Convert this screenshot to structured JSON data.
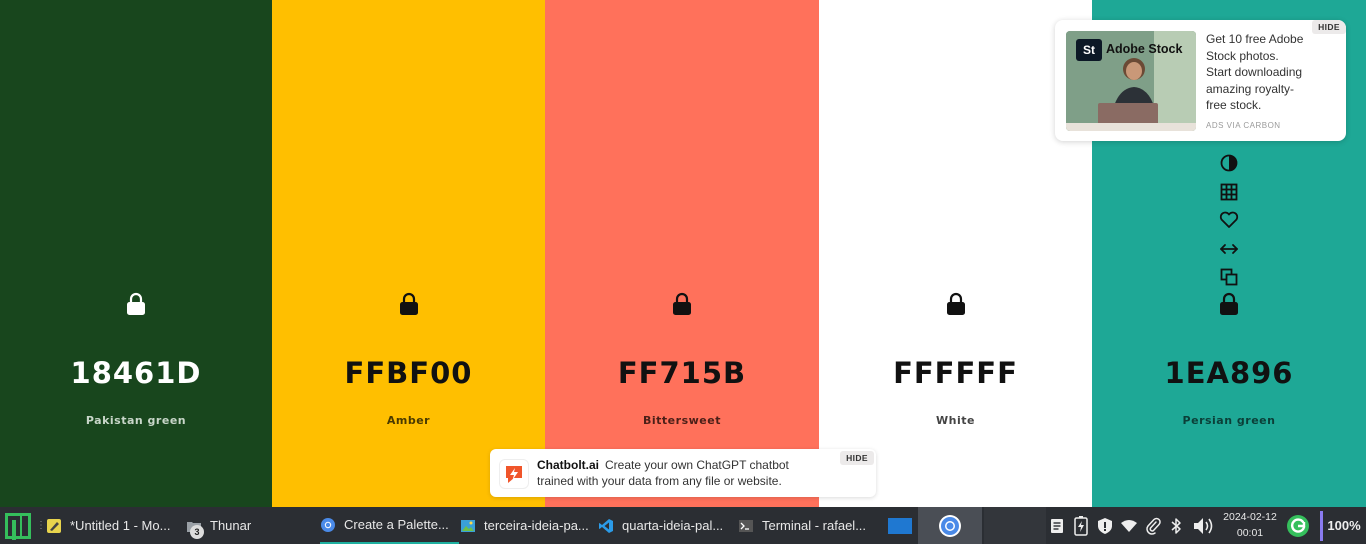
{
  "palette": {
    "colors": [
      {
        "hex": "18461D",
        "name": "Pakistan green",
        "bg": "#18461D",
        "fg": "#ffffff",
        "sub": "#c8d6c9"
      },
      {
        "hex": "FFBF00",
        "name": "Amber",
        "bg": "#FFBF00",
        "fg": "#111111",
        "sub": "#4a3a00"
      },
      {
        "hex": "FF715B",
        "name": "Bittersweet",
        "bg": "#FF715B",
        "fg": "#111111",
        "sub": "#4a1f18"
      },
      {
        "hex": "FFFFFF",
        "name": "White",
        "bg": "#FFFFFF",
        "fg": "#111111",
        "sub": "#444444"
      },
      {
        "hex": "1EA896",
        "name": "Persian green",
        "bg": "#1EA896",
        "fg": "#111111",
        "sub": "#0b3f38"
      }
    ],
    "tools": [
      "contrast-icon",
      "shades-grid-icon",
      "heart-icon",
      "drag-arrows-icon",
      "copy-icon"
    ]
  },
  "adobe_ad": {
    "brand": "Adobe Stock",
    "logo_text": "St",
    "text": "Get 10 free Adobe Stock photos. Start downloading amazing royalty-free stock.",
    "via": "ADS VIA CARBON",
    "hide_label": "HIDE"
  },
  "chatbolt_ad": {
    "brand": "Chatbolt.ai",
    "text": "Create your own ChatGPT chatbot trained with your data from any file or website.",
    "hide_label": "HIDE"
  },
  "taskbar": {
    "items": [
      {
        "label": "*Untitled 1 - Mo..."
      },
      {
        "label": "Thunar",
        "badge": "3"
      },
      {
        "label": "Create a Palette..."
      },
      {
        "label": "terceira-ideia-pa..."
      },
      {
        "label": "quarta-ideia-pal..."
      },
      {
        "label": "Terminal - rafael..."
      }
    ],
    "date": "2024-02-12",
    "time": "00:01",
    "battery": "100%",
    "accent": "#1eb0a0"
  }
}
